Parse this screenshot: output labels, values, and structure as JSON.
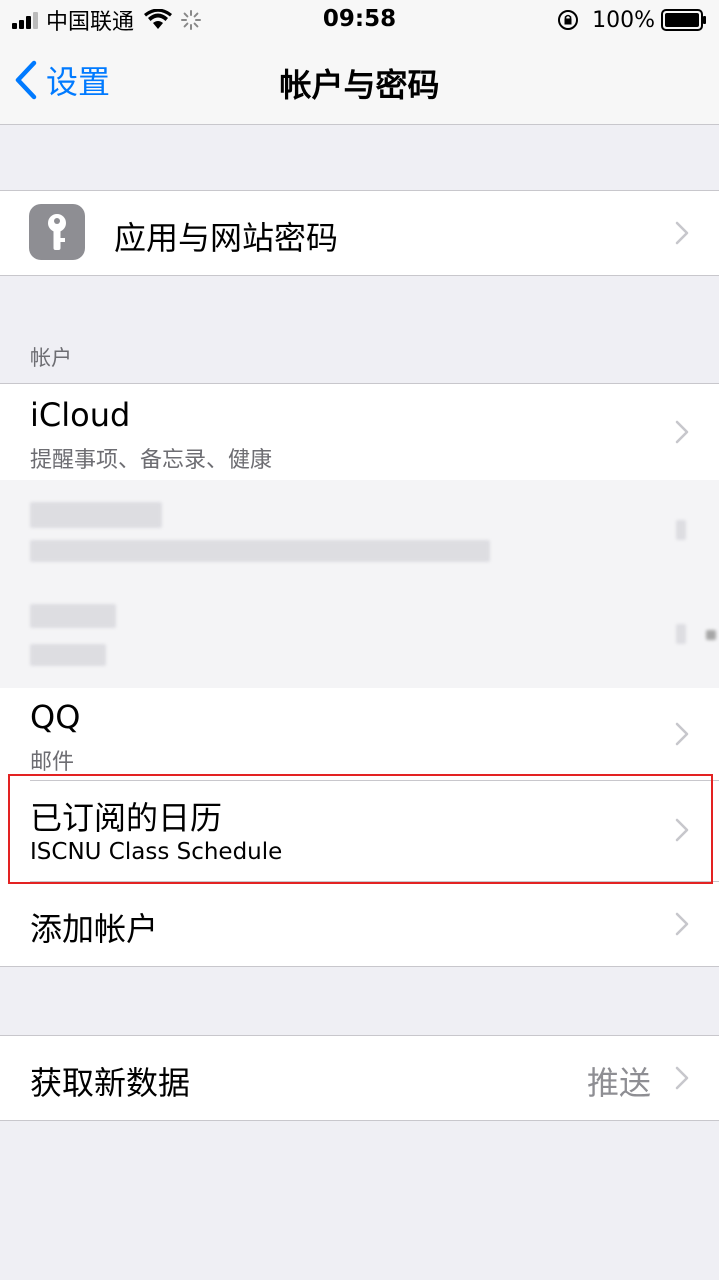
{
  "status_bar": {
    "carrier": "中国联通",
    "time": "09:58",
    "battery_percent": "100%"
  },
  "nav": {
    "back_label": "设置",
    "title": "帐户与密码"
  },
  "passwords": {
    "label": "应用与网站密码",
    "icon": "key-icon"
  },
  "accounts_section": {
    "header": "帐户",
    "items": [
      {
        "title": "iCloud",
        "subtitle": "提醒事项、备忘录、健康"
      },
      {
        "title": "QQ",
        "subtitle": "邮件"
      },
      {
        "title": "已订阅的日历",
        "subtitle": "ISCNU Class Schedule"
      }
    ],
    "add_account": "添加帐户"
  },
  "fetch": {
    "label": "获取新数据",
    "value": "推送"
  },
  "colors": {
    "accent": "#007aff",
    "highlight": "#e32222",
    "background": "#efeff4"
  }
}
